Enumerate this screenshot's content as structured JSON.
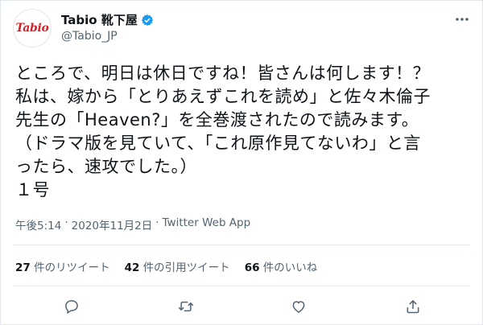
{
  "user": {
    "display_name": "Tabio 靴下屋",
    "handle": "@Tabio_JP",
    "avatar_text": "Tabio"
  },
  "tweet": {
    "text": "ところで、明日は休日ですね！皆さんは何します！？\n私は、嫁から「とりあえずこれを読め」と佐々木倫子\n先生の「Heaven?」を全巻渡されたので読みます。\n（ドラマ版を見ていて、「これ原作見てないわ」と言\nったら、速攻でした。）\n１号",
    "time": "午後5:14",
    "separator": "·",
    "date": "2020年11月2日",
    "source": "Twitter Web App"
  },
  "stats": {
    "retweets_count": "27",
    "retweets_label": "件のリツイート",
    "quotes_count": "42",
    "quotes_label": "件の引用ツイート",
    "likes_count": "66",
    "likes_label": "件のいいね"
  },
  "icons": {
    "verified": "verified-badge-icon",
    "more": "more-dots-icon",
    "reply": "reply-icon",
    "retweet": "retweet-icon",
    "like": "heart-icon",
    "share": "share-icon"
  },
  "colors": {
    "accent": "#1d9bf0",
    "brand_red": "#d2232a",
    "secondary_text": "#536471"
  }
}
